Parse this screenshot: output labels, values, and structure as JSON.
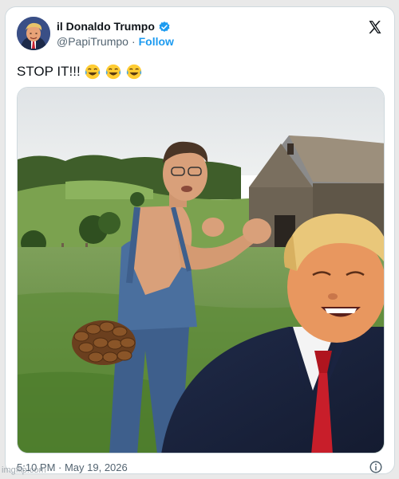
{
  "author": {
    "display_name": "il Donaldo Trumpo",
    "handle": "@PapiTrumpo",
    "separator": "·",
    "follow_label": "Follow"
  },
  "tweet": {
    "text": "STOP IT!!!",
    "emojis": [
      "laughing-tears-emoji",
      "laughing-tears-emoji",
      "laughing-tears-emoji"
    ],
    "timestamp": "5:10 PM · May 19, 2026"
  },
  "watermark": "imgflip.com",
  "icons": {
    "verified": "verified-badge-icon",
    "logo": "x-logo-icon",
    "info": "info-icon"
  },
  "colors": {
    "accent": "#1d9bf0",
    "text": "#0f1419",
    "muted": "#536471"
  }
}
